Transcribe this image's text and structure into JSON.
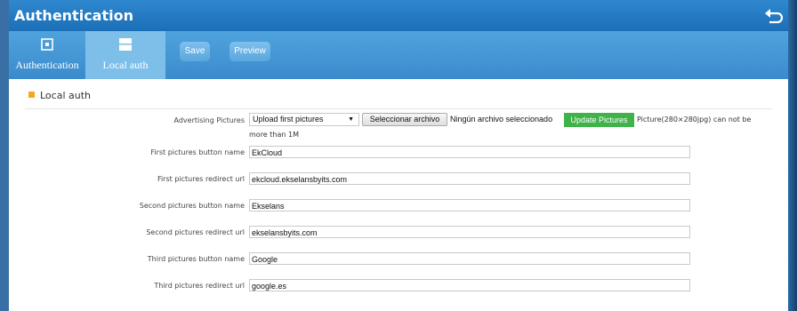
{
  "window": {
    "title": "Authentication"
  },
  "tabs": [
    {
      "label": "Authentication",
      "icon": "square-dot-icon"
    },
    {
      "label": "Local auth",
      "icon": "window-icon"
    }
  ],
  "toolbar": {
    "save_label": "Save",
    "preview_label": "Preview"
  },
  "section": {
    "title": "Local auth"
  },
  "advertising": {
    "label": "Advertising Pictures",
    "select_value": "Upload first pictures",
    "file_button": "Seleccionar archivo",
    "file_status": "Ningún archivo seleccionado",
    "update_button": "Update Pictures",
    "hint_line1": "Picture(280×280jpg) can not be",
    "hint_line2": "more than 1M"
  },
  "fields": [
    {
      "label": "First pictures button name",
      "value": "EkCloud"
    },
    {
      "label": "First pictures redirect url",
      "value": "ekcloud.ekselansbyits.com"
    },
    {
      "label": "Second pictures button name",
      "value": "Ekselans"
    },
    {
      "label": "Second pictures redirect url",
      "value": "ekselansbyits.com"
    },
    {
      "label": "Third pictures button name",
      "value": "Google"
    },
    {
      "label": "Third pictures redirect url",
      "value": "google.es"
    }
  ],
  "colors": {
    "titlebar": "#1b6fb7",
    "toolbar": "#3b8bcc",
    "active_tab": "#7dbfe9",
    "update_button": "#3fb34a",
    "bullet": "#f5a623"
  }
}
